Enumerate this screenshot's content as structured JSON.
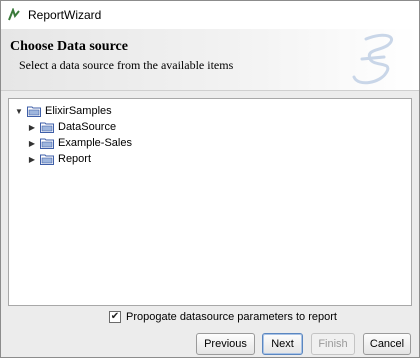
{
  "window": {
    "title": "ReportWizard"
  },
  "header": {
    "title": "Choose Data source",
    "subtitle": "Select a data source from the available items"
  },
  "tree": {
    "root": {
      "label": "ElixirSamples",
      "expanded": true
    },
    "children": [
      {
        "label": "DataSource",
        "expanded": false
      },
      {
        "label": "Example-Sales",
        "expanded": false
      },
      {
        "label": "Report",
        "expanded": false
      }
    ]
  },
  "options": {
    "propagate_label": "Propogate datasource parameters to report",
    "propagate_checked": true
  },
  "buttons": {
    "previous": "Previous",
    "next": "Next",
    "finish": "Finish",
    "cancel": "Cancel"
  },
  "colors": {
    "accent": "#5a86c0",
    "folder": "#3f5fa8"
  }
}
